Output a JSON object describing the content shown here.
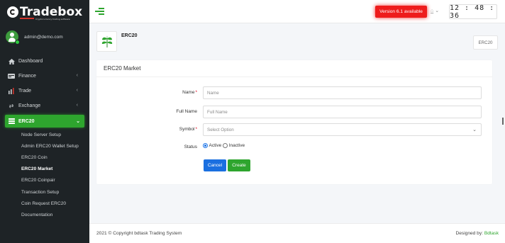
{
  "brand": {
    "name": "Tradebox",
    "tagline": "Cryptocurrency trading software"
  },
  "user": {
    "email": "admin@demo.com"
  },
  "sidebar": {
    "items": [
      {
        "label": "Dashboard",
        "icon": "home-icon"
      },
      {
        "label": "Finance",
        "icon": "finance-icon"
      },
      {
        "label": "Trade",
        "icon": "trade-chart-icon"
      },
      {
        "label": "Exchange",
        "icon": "exchange-icon"
      },
      {
        "label": "ERC20",
        "icon": "erc20-icon"
      }
    ],
    "submenu": [
      "Node Server Setup",
      "Admin ERC20 Wallet Setup",
      "ERC20 Coin",
      "ERC20 Market",
      "ERC20 Coinpair",
      "Transaction Setup",
      "Coin Request ERC20",
      "Documentation"
    ]
  },
  "topbar": {
    "version": "Version 6.1 available",
    "clock": "12:48:36"
  },
  "page": {
    "title": "ERC20",
    "crumb": "ERC20"
  },
  "card": {
    "title": "ERC20 Market",
    "form": {
      "name_label": "Name",
      "name_placeholder": "Name",
      "fullname_label": "Full Name",
      "fullname_placeholder": "Full Name",
      "symbol_label": "Symbol",
      "symbol_placeholder": "Select Option",
      "status_label": "Status",
      "status_active": "Active",
      "status_inactive": "Inactive",
      "required_mark": "*",
      "cancel": "Cancel",
      "create": "Create"
    }
  },
  "footer": {
    "copyright": "2021 © Copyright bdtask Trading System",
    "designed_by": "Designed by:",
    "designer": "Bdtask"
  },
  "colors": {
    "accent": "#2ea52e",
    "sidebar_bg": "#1e2326",
    "version_badge": "#ee1c1c",
    "cancel_button": "#1a6fe0"
  }
}
